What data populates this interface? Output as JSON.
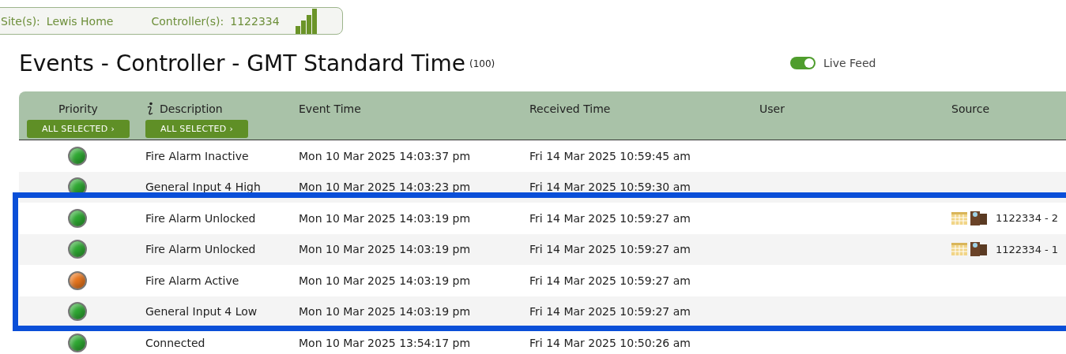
{
  "site_bar": {
    "site_label": "Site(s):",
    "site": "Lewis Home",
    "controller_label": "Controller(s):",
    "controller": "1122334"
  },
  "title": "Events - Controller - GMT Standard Time",
  "count": "(100)",
  "live_feed": {
    "label": "Live Feed",
    "on": true
  },
  "table": {
    "columns": [
      {
        "label": "Priority",
        "filter": "ALL SELECTED ›",
        "info": false
      },
      {
        "label": "Description",
        "filter": "ALL SELECTED ›",
        "info": true
      },
      {
        "label": "Event Time"
      },
      {
        "label": "Received Time"
      },
      {
        "label": "User"
      },
      {
        "label": "Source"
      }
    ],
    "rows": [
      {
        "color": "#2ea832",
        "description": "Fire Alarm Inactive",
        "event_time": "Mon 10 Mar 2025 14:03:37 pm",
        "received_time": "Fri 14 Mar 2025 10:59:45 am"
      },
      {
        "color": "#2ea832",
        "description": "General Input 4 High",
        "event_time": "Mon 10 Mar 2025 14:03:23 pm",
        "received_time": "Fri 14 Mar 2025 10:59:30 am"
      },
      {
        "color": "#2ea832",
        "description": "Fire Alarm Unlocked",
        "event_time": "Mon 10 Mar 2025 14:03:19 pm",
        "received_time": "Fri 14 Mar 2025 10:59:27 am",
        "source": "1122334 - 2"
      },
      {
        "color": "#2ea832",
        "description": "Fire Alarm Unlocked",
        "event_time": "Mon 10 Mar 2025 14:03:19 pm",
        "received_time": "Fri 14 Mar 2025 10:59:27 am",
        "source": "1122334 - 1"
      },
      {
        "color": "#e8761e",
        "description": "Fire Alarm Active",
        "event_time": "Mon 10 Mar 2025 14:03:19 pm",
        "received_time": "Fri 14 Mar 2025 10:59:27 am"
      },
      {
        "color": "#2ea832",
        "description": "General Input 4 Low",
        "event_time": "Mon 10 Mar 2025 14:03:19 pm",
        "received_time": "Fri 14 Mar 2025 10:59:27 am"
      },
      {
        "color": "#2ea832",
        "description": "Connected",
        "event_time": "Mon 10 Mar 2025 13:54:17 pm",
        "received_time": "Fri 14 Mar 2025 10:50:26 am"
      }
    ]
  }
}
